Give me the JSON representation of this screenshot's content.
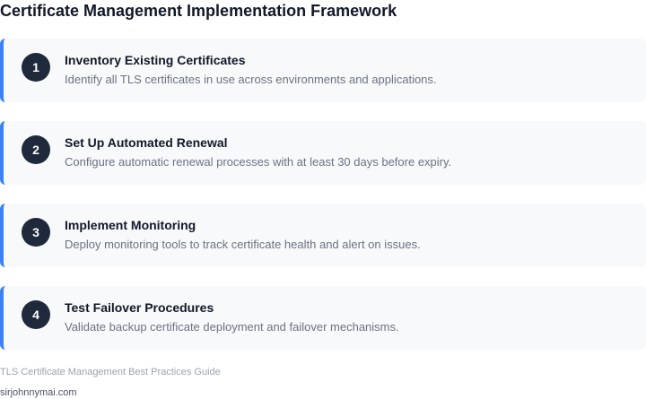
{
  "header": {
    "title": "Certificate Management Implementation Framework"
  },
  "steps": [
    {
      "number": "1",
      "title": "Inventory Existing Certificates",
      "description": "Identify all TLS certificates in use across environments and applications."
    },
    {
      "number": "2",
      "title": "Set Up Automated Renewal",
      "description": "Configure automatic renewal processes with at least 30 days before expiry."
    },
    {
      "number": "3",
      "title": "Implement Monitoring",
      "description": "Deploy monitoring tools to track certificate health and alert on issues."
    },
    {
      "number": "4",
      "title": "Test Failover Procedures",
      "description": "Validate backup certificate deployment and failover mechanisms."
    }
  ],
  "footer": {
    "note": "TLS Certificate Management Best Practices Guide",
    "site": "sirjohnnymai.com"
  },
  "colors": {
    "accent": "#3b82f6",
    "badge": "#1e293b",
    "card_bg": "#f8f9fb"
  }
}
